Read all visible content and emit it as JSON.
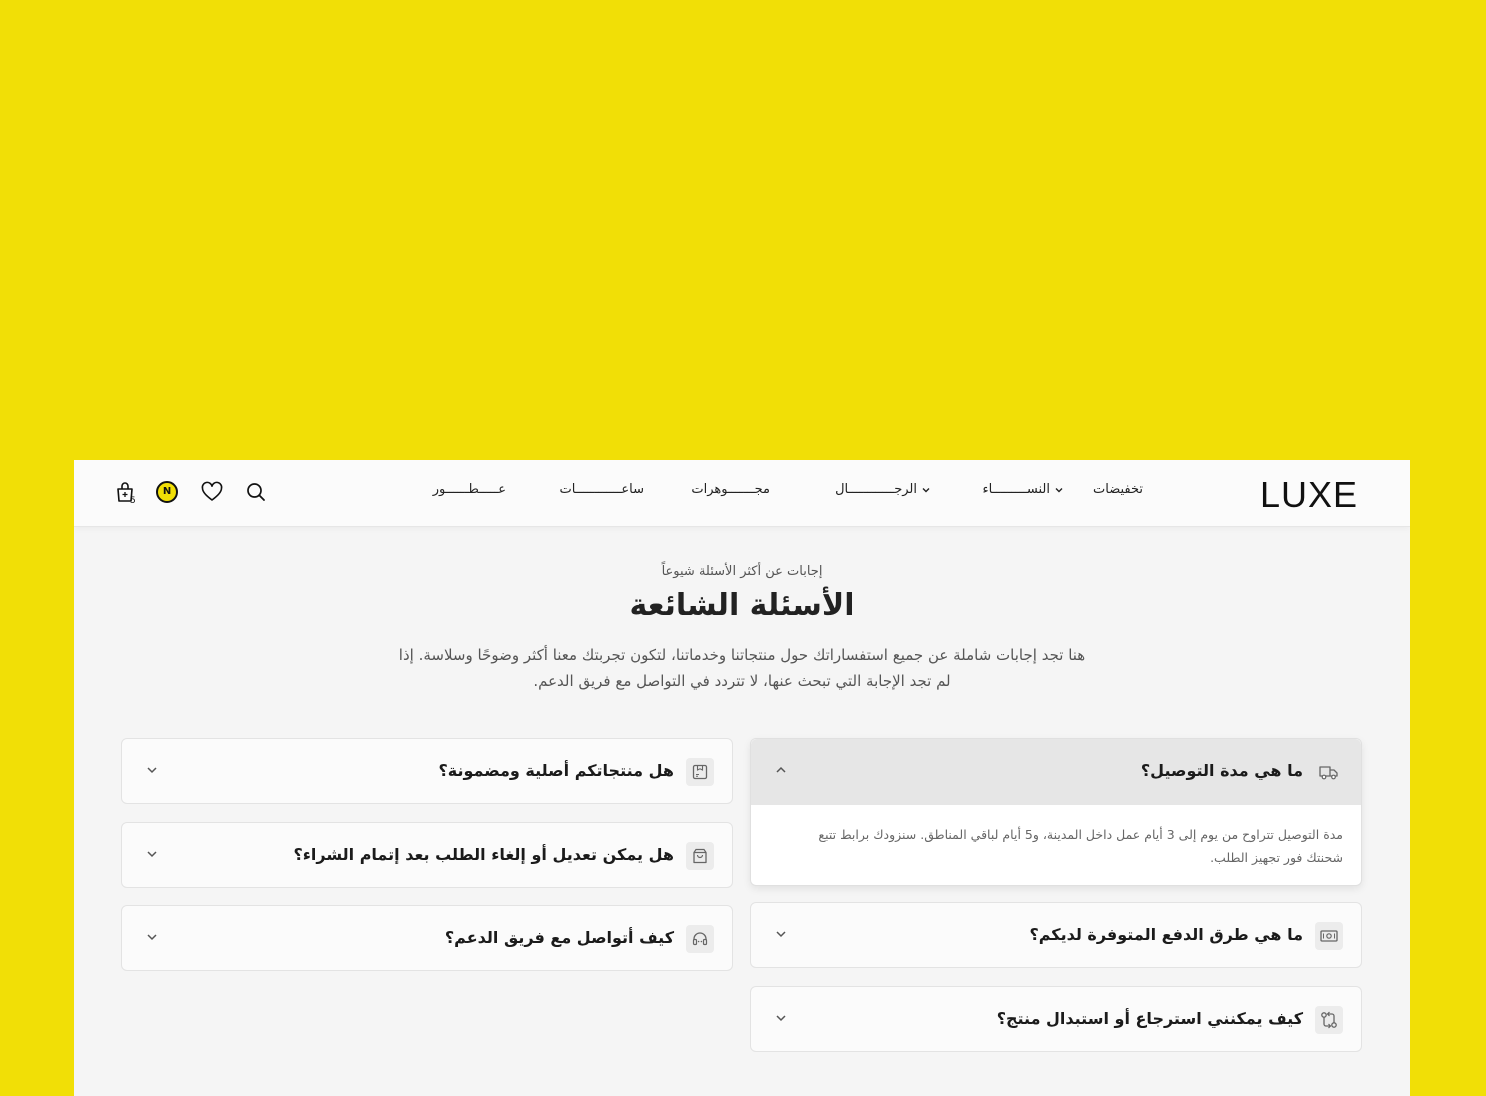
{
  "header": {
    "logo": "LUXE",
    "nav": [
      {
        "label": "تخفيضات",
        "has_dropdown": false
      },
      {
        "label": "النســـــــــاء",
        "has_dropdown": true
      },
      {
        "label": "الرجــــــــــــال",
        "has_dropdown": true
      },
      {
        "label": "مجـــــــوهرات",
        "has_dropdown": false
      },
      {
        "label": "ساعــــــــــــات",
        "has_dropdown": false
      },
      {
        "label": "عـــــطــــــور",
        "has_dropdown": false
      }
    ],
    "cart_count": "5",
    "icons": [
      "search-icon",
      "heart-icon",
      "account-badge-icon",
      "cart-icon"
    ]
  },
  "faq": {
    "eyebrow": "إجابات عن أكثر الأسئلة شيوعاً",
    "title": "الأسئلة الشائعة",
    "description": "هنا تجد إجابات شاملة عن جميع استفساراتك حول منتجاتنا وخدماتنا، لتكون تجربتك معنا أكثر وضوحًا وسلاسة. إذا لم تجد الإجابة التي تبحث عنها، لا تتردد في التواصل مع فريق الدعم.",
    "right_column": [
      {
        "question": "ما هي مدة التوصيل؟",
        "icon": "delivery-truck-icon",
        "expanded": true,
        "answer": "مدة التوصيل تتراوح من يوم إلى 3 أيام عمل داخل المدينة، و5 أيام لباقي المناطق. سنزودك برابط تتبع شحنتك فور تجهيز الطلب."
      },
      {
        "question": "ما هي طرق الدفع المتوفرة لديكم؟",
        "icon": "cash-icon",
        "expanded": false
      },
      {
        "question": "كيف يمكنني استرجاع أو استبدال منتج؟",
        "icon": "exchange-icon",
        "expanded": false
      }
    ],
    "left_column": [
      {
        "question": "هل منتجاتكم أصلية ومضمونة؟",
        "icon": "certificate-box-icon",
        "expanded": false
      },
      {
        "question": "هل يمكن تعديل أو إلغاء الطلب بعد إتمام الشراء؟",
        "icon": "shopping-bag-icon",
        "expanded": false
      },
      {
        "question": "كيف أتواصل مع فريق الدعم؟",
        "icon": "headset-icon",
        "expanded": false
      }
    ]
  }
}
